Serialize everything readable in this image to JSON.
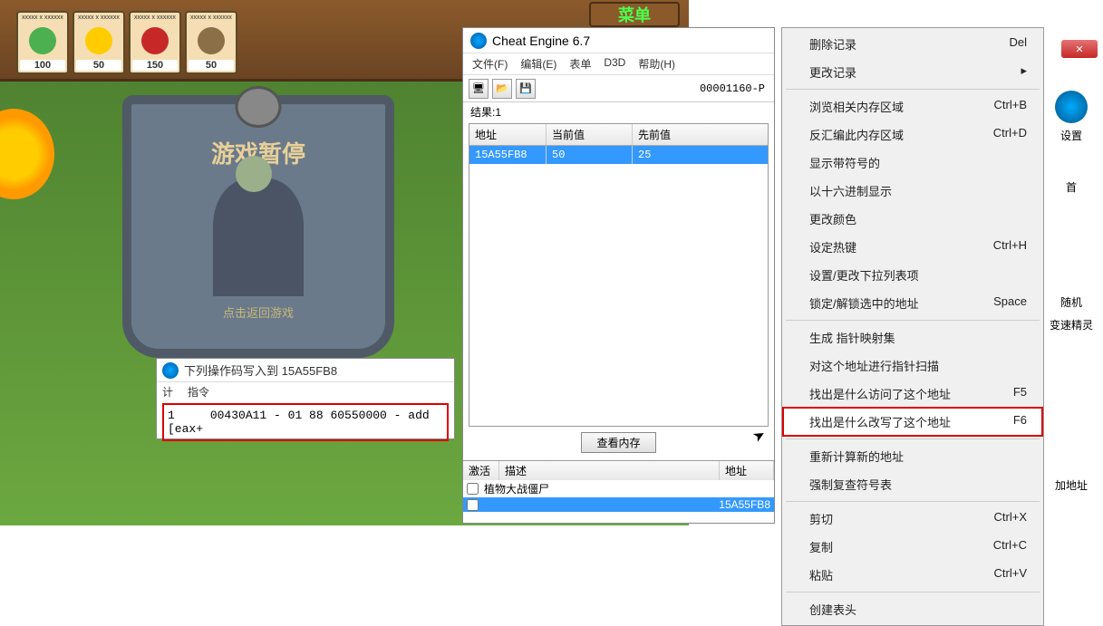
{
  "game": {
    "menu_label": "菜单",
    "seeds": [
      {
        "cost": "100",
        "color": "#4caf50"
      },
      {
        "cost": "50",
        "color": "#ffcc00"
      },
      {
        "cost": "150",
        "color": "#c62828"
      },
      {
        "cost": "50",
        "color": "#8b6f47"
      }
    ],
    "seed_tiny": "xxxxx x xxxxxx",
    "pause_title": "游戏暂停",
    "pause_hint": "点击返回游戏"
  },
  "opcode": {
    "title": "下列操作码写入到 15A55FB8",
    "col_count": "计",
    "col_instr": "指令",
    "row_count": "1",
    "row_instr": "00430A11 - 01 88 60550000  - add [eax+"
  },
  "ce": {
    "title": "Cheat Engine 6.7",
    "menu": [
      "文件(F)",
      "编辑(E)",
      "表单",
      "D3D",
      "帮助(H)"
    ],
    "pid": "00001160-P",
    "results_label": "结果:",
    "results_count": "1",
    "col_addr": "地址",
    "col_cur": "当前值",
    "col_prev": "先前值",
    "row_addr": "15A55FB8",
    "row_cur": "50",
    "row_prev": "25",
    "viewmem": "查看内存",
    "bottom_cols": {
      "active": "激活",
      "desc": "描述",
      "addr": "地址"
    },
    "proc_name": "植物大战僵尸",
    "proc_sel_addr": "15A55FB8"
  },
  "ctx": {
    "items": [
      {
        "label": "删除记录",
        "shortcut": "Del"
      },
      {
        "label": "更改记录",
        "arrow": true
      },
      {
        "sep": true
      },
      {
        "label": "浏览相关内存区域",
        "shortcut": "Ctrl+B"
      },
      {
        "label": "反汇编此内存区域",
        "shortcut": "Ctrl+D"
      },
      {
        "label": "显示带符号的"
      },
      {
        "label": "以十六进制显示"
      },
      {
        "label": "更改颜色"
      },
      {
        "label": "设定热键",
        "shortcut": "Ctrl+H"
      },
      {
        "label": "设置/更改下拉列表项"
      },
      {
        "label": "锁定/解锁选中的地址",
        "shortcut": "Space"
      },
      {
        "sep": true
      },
      {
        "label": "生成 指针映射集"
      },
      {
        "label": "对这个地址进行指针扫描"
      },
      {
        "label": "找出是什么访问了这个地址",
        "shortcut": "F5"
      },
      {
        "label": "找出是什么改写了这个地址",
        "shortcut": "F6",
        "hl": true
      },
      {
        "sep": true
      },
      {
        "label": "重新计算新的地址"
      },
      {
        "label": "强制复查符号表"
      },
      {
        "sep": true
      },
      {
        "label": "剪切",
        "shortcut": "Ctrl+X"
      },
      {
        "label": "复制",
        "shortcut": "Ctrl+C"
      },
      {
        "label": "粘贴",
        "shortcut": "Ctrl+V"
      },
      {
        "sep": true
      },
      {
        "label": "创建表头"
      }
    ]
  },
  "right": {
    "close": "✕",
    "settings": "设置",
    "items": [
      "首",
      "随机",
      "变速精灵",
      "加地址"
    ]
  }
}
